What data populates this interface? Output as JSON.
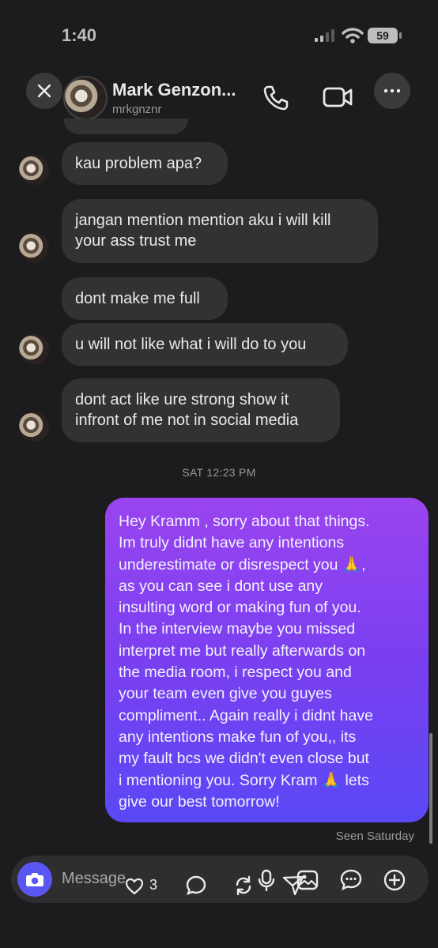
{
  "status_bar": {
    "time": "1:40",
    "battery": "59"
  },
  "header": {
    "name": "Mark Genzon...",
    "handle": "mrkgnznr"
  },
  "messages_in": [
    {
      "text": "kau problem apa?"
    },
    {
      "text": "jangan mention mention aku i will kill your ass trust me"
    },
    {
      "text": "dont make me full"
    },
    {
      "text": "u will not like what i will do to you"
    },
    {
      "text": "dont act like ure strong show it infront of me not in social media"
    }
  ],
  "timestamp": "SAT 12:23 PM",
  "outgoing": {
    "lines": [
      "Hey Kramm , sorry about that things.",
      "Im truly didnt have any intentions",
      "underestimate or disrespect you 🙏,",
      "as you can see i dont use any",
      "insulting word or making fun of you.",
      "In the interview maybe you missed",
      "interpret me but really afterwards on",
      "the media room, i respect you and",
      "your team even give you guyes",
      "compliment.. Again really i didnt have",
      "any intentions make fun of you,, its",
      "my fault bcs we didn't even close but",
      "i mentioning you. Sorry Kram 🙏 lets",
      "give our best tomorrow!"
    ]
  },
  "seen": "Seen Saturday",
  "composer": {
    "placeholder": "Message",
    "like_count": "3"
  },
  "colors": {
    "background": "#1c1c1e",
    "incoming_bubble": "#323235",
    "outgoing_gradient_top": "#9a44ef",
    "outgoing_gradient_bottom": "#5a48f5",
    "camera_button": "#5a56f3"
  }
}
